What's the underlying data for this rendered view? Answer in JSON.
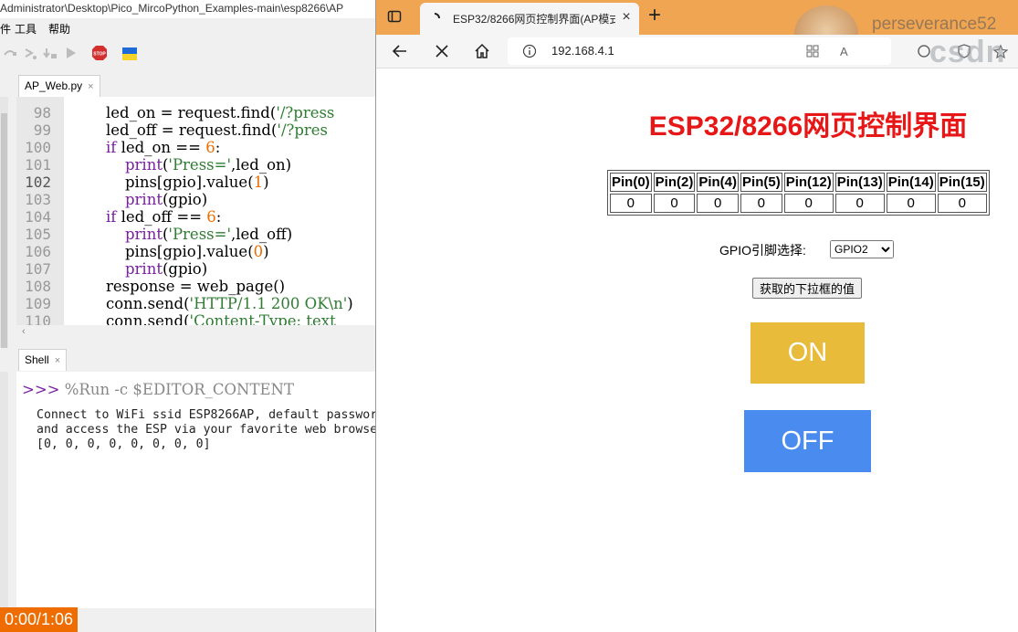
{
  "ide": {
    "title_path": "Administrator\\Desktop\\Pico_MircoPython_Examples-main\\esp8266\\AP",
    "menu": [
      "件",
      "工具",
      "帮助"
    ],
    "toolbar_icons": [
      "debug-icon",
      "step-over-icon",
      "step-into-icon",
      "resume-icon",
      "stop-icon",
      "flag-icon"
    ],
    "editor_tab": "AP_Web.py",
    "line_numbers": [
      "98",
      "99",
      "100",
      "101",
      "102",
      "103",
      "104",
      "105",
      "106",
      "107",
      "108",
      "109",
      "110"
    ],
    "current_line": "102",
    "code_lines": [
      "led_on = request.find('/?press",
      "led_off = request.find('/?pres",
      "if led_on == 6:",
      "    print('Press=',led_on)",
      "    pins[gpio].value(1)",
      "    print(gpio)",
      "if led_off == 6:",
      "    print('Press=',led_off)",
      "    pins[gpio].value(0)",
      "    print(gpio)",
      "response = web_page()",
      "conn.send('HTTP/1.1 200 OK\\n')",
      "conn.send('Content-Type: text"
    ],
    "shell_tab": "Shell",
    "shell_prompt_arrows": ">>>",
    "shell_command": "%Run -c $EDITOR_CONTENT",
    "shell_output": [
      "Connect to WiFi ssid ESP8266AP, default passwor",
      "and access the ESP via your favorite web browse",
      "[0, 0, 0, 0, 0, 0, 0, 0]"
    ],
    "video_time": "0:00/1:06"
  },
  "browser": {
    "tab_title": "ESP32/8266网页控制界面(AP模式",
    "url": "192.168.4.1",
    "watermark_user": "perseverance52",
    "watermark_brand": "csdn",
    "page": {
      "heading": "ESP32/8266网页控制界面",
      "pin_headers": [
        "Pin(0)",
        "Pin(2)",
        "Pin(4)",
        "Pin(5)",
        "Pin(12)",
        "Pin(13)",
        "Pin(14)",
        "Pin(15)"
      ],
      "pin_values": [
        "0",
        "0",
        "0",
        "0",
        "0",
        "0",
        "0",
        "0"
      ],
      "gpio_label": "GPIO引脚选择:",
      "gpio_selected": "GPIO2",
      "get_value_button": "获取的下拉框的值",
      "on_button": "ON",
      "off_button": "OFF"
    }
  },
  "colors": {
    "heading_red": "#e81717",
    "on_yellow": "#e8bb3a",
    "off_blue": "#4a8bf0",
    "tabstrip_orange": "#efa552",
    "time_orange": "#ef6c00"
  }
}
